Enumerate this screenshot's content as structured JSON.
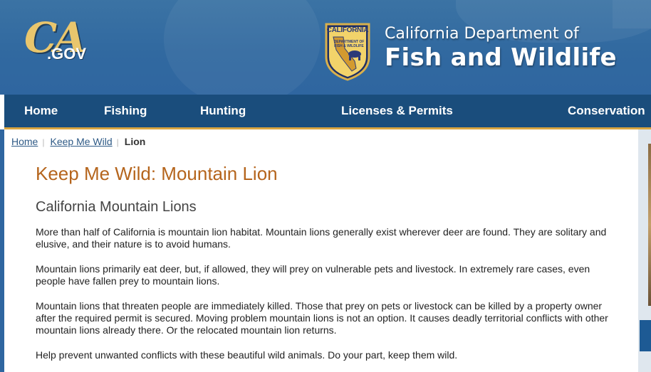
{
  "header": {
    "ca_logo": {
      "letters": "CA",
      "suffix": ".GOV"
    },
    "badge": {
      "top_text": "CALIFORNIA",
      "inner_text": "DEPARTMENT OF FISH & WILDLIFE"
    },
    "agency_line1": "California Department of",
    "agency_line2": "Fish and Wildlife"
  },
  "nav": {
    "items": [
      {
        "label": "Home"
      },
      {
        "label": "Fishing"
      },
      {
        "label": "Hunting"
      },
      {
        "label": "Licenses & Permits"
      },
      {
        "label": "Conservation"
      }
    ]
  },
  "breadcrumb": {
    "items": [
      {
        "label": "Home"
      },
      {
        "label": "Keep Me Wild"
      }
    ],
    "current": "Lion"
  },
  "main": {
    "title": "Keep Me Wild: Mountain Lion",
    "heading": "California Mountain Lions",
    "paragraphs": [
      "More than half of California is mountain lion habitat. Mountain lions generally exist wherever deer are found. They are solitary and elusive, and their nature is to avoid humans.",
      "Mountain lions primarily eat deer, but, if allowed, they will prey on vulnerable pets and livestock. In extremely rare cases, even people have fallen prey to mountain lions.",
      "Mountain lions that threaten people are immediately killed. Those that prey on pets or livestock can be killed by a property owner after the required permit is secured. Moving problem mountain lions is not an option. It causes deadly territorial conflicts with other mountain lions already there. Or the relocated mountain lion returns.",
      "Help prevent unwanted conflicts with these beautiful wild animals. Do your part, keep them wild."
    ]
  },
  "colors": {
    "header_blue": "#3169a0",
    "nav_blue": "#1a4d7c",
    "nav_underline": "#d9a540",
    "title_orange": "#b5651d",
    "link_blue": "#2e5a86"
  }
}
